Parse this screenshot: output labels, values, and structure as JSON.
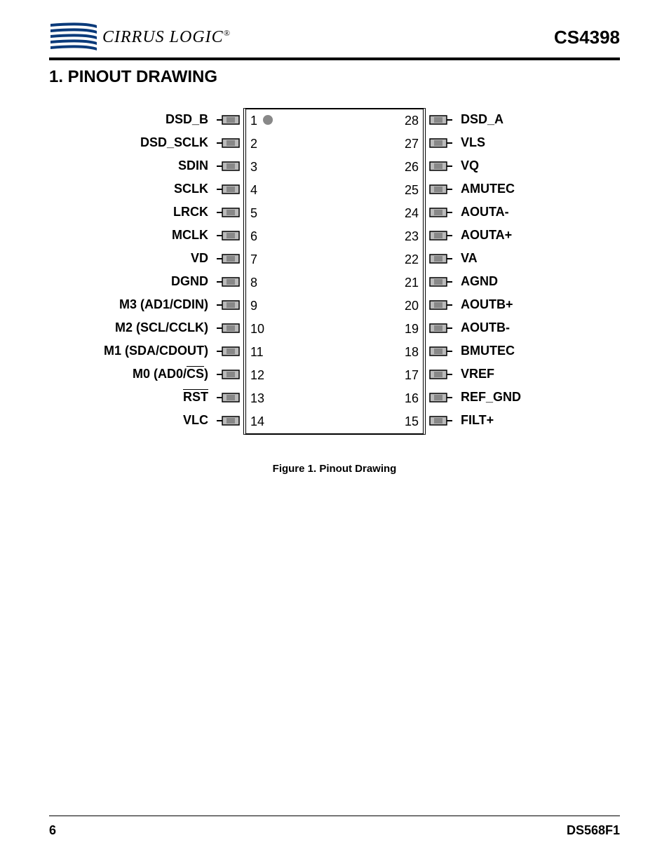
{
  "header": {
    "logo_text": "CIRRUS LOGIC",
    "logo_reg": "®",
    "part_number": "CS4398"
  },
  "section": {
    "title": "1. PINOUT DRAWING"
  },
  "pins_left": [
    {
      "label": "DSD_B",
      "num": 1,
      "overline_idx": null
    },
    {
      "label": "DSD_SCLK",
      "num": 2,
      "overline_idx": null
    },
    {
      "label": "SDIN",
      "num": 3,
      "overline_idx": null
    },
    {
      "label": "SCLK",
      "num": 4,
      "overline_idx": null
    },
    {
      "label": "LRCK",
      "num": 5,
      "overline_idx": null
    },
    {
      "label": "MCLK",
      "num": 6,
      "overline_idx": null
    },
    {
      "label": "VD",
      "num": 7,
      "overline_idx": null
    },
    {
      "label": "DGND",
      "num": 8,
      "overline_idx": null
    },
    {
      "label": "M3 (AD1/CDIN)",
      "num": 9,
      "overline_idx": null
    },
    {
      "label": "M2 (SCL/CCLK)",
      "num": 10,
      "overline_idx": null
    },
    {
      "label": "M1 (SDA/CDOUT)",
      "num": 11,
      "overline_idx": null
    },
    {
      "label_pre": "M0 (AD0/",
      "label_over": "CS",
      "label_post": ")",
      "num": 12,
      "overline_idx": 1
    },
    {
      "label_over": "RST",
      "num": 13,
      "overline_idx": 2
    },
    {
      "label": "VLC",
      "num": 14,
      "overline_idx": null
    }
  ],
  "pins_right": [
    {
      "label": "DSD_A",
      "num": 28
    },
    {
      "label": "VLS",
      "num": 27
    },
    {
      "label": "VQ",
      "num": 26
    },
    {
      "label": "AMUTEC",
      "num": 25
    },
    {
      "label": "AOUTA-",
      "num": 24
    },
    {
      "label": "AOUTA+",
      "num": 23
    },
    {
      "label": "VA",
      "num": 22
    },
    {
      "label": "AGND",
      "num": 21
    },
    {
      "label": "AOUTB+",
      "num": 20
    },
    {
      "label": "AOUTB-",
      "num": 19
    },
    {
      "label": "BMUTEC",
      "num": 18
    },
    {
      "label": "VREF",
      "num": 17
    },
    {
      "label": "REF_GND",
      "num": 16
    },
    {
      "label": "FILT+",
      "num": 15
    }
  ],
  "caption": "Figure 1.  Pinout Drawing",
  "footer": {
    "page": "6",
    "doc": "DS568F1"
  }
}
